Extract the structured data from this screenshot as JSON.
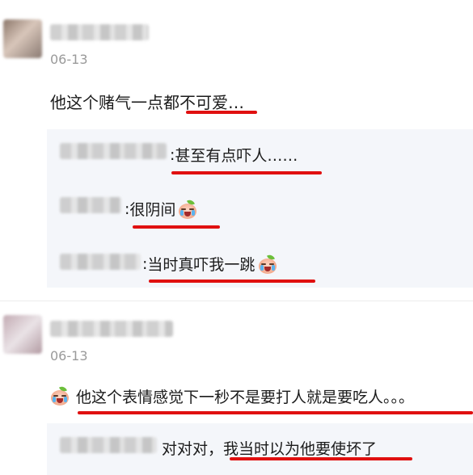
{
  "comments": [
    {
      "date": "06-13",
      "text": "他这个赌气一点都不可爱…",
      "replies": [
        {
          "sep": ": ",
          "text": "甚至有点吓人……"
        },
        {
          "sep": ": ",
          "text": "很阴间"
        },
        {
          "sep": ": ",
          "text": "当时真吓我一跳"
        }
      ]
    },
    {
      "date": "06-13",
      "text": "他这个表情感觉下一秒不是要打人就是要吃人。。。",
      "replies": [
        {
          "sep": "对对对，",
          "text": "我当时以为他要使坏了"
        }
      ]
    }
  ],
  "emoji_icon": "crying-sprout-baby-emoji",
  "colors": {
    "underline": "#e01010",
    "reply_bg": "#f4f6fa",
    "date": "#9a9a9a"
  }
}
